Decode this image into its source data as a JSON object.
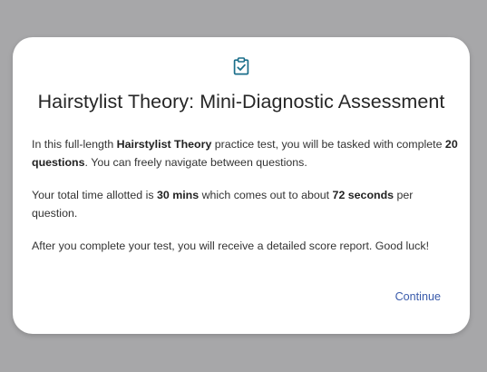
{
  "modal": {
    "icon": "clipboard-check-icon",
    "accent_color": "#1a6e8a",
    "title": "Hairstylist Theory: Mini-Diagnostic Assessment",
    "p1": {
      "a": "In this full-length ",
      "b": "Hairstylist Theory",
      "c": " practice test, you will be tasked with complete ",
      "d": "20 questions",
      "e": ". You can freely navigate between questions."
    },
    "p2": {
      "a": "Your total time allotted is ",
      "b": "30 mins",
      "c": " which comes out to about ",
      "d": "72 seconds",
      "e": " per question."
    },
    "p3": "After you complete your test, you will receive a detailed score report. Good luck!",
    "continue_label": "Continue",
    "link_color": "#3a5bab"
  }
}
